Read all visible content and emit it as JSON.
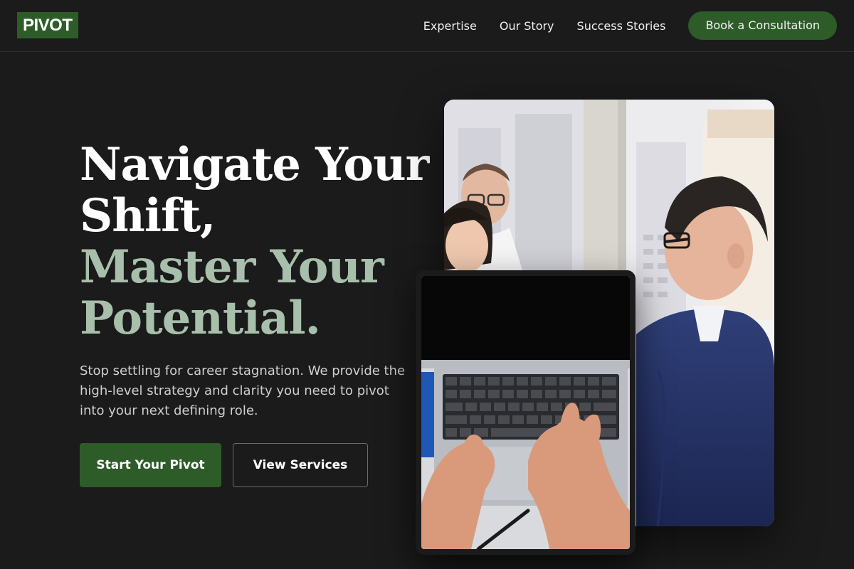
{
  "brand": {
    "logo": "PIVOT",
    "accent": "#2e5c29",
    "highlight": "#a7bfab"
  },
  "nav": {
    "links": [
      "Expertise",
      "Our Story",
      "Success Stories"
    ],
    "cta": "Book a Consultation"
  },
  "hero": {
    "headline_line1": "Navigate Your",
    "headline_line2": "Shift,",
    "headline_line3": "Master Your",
    "headline_line4": "Potential.",
    "subtitle": "Stop settling for career stagnation. We provide the high-level strategy and clarity you need to pivot into your next defining role.",
    "primary_button": "Start Your Pivot",
    "secondary_button": "View Services"
  },
  "images": {
    "meeting": "business-meeting-photo",
    "laptop": "laptop-typing-photo"
  }
}
